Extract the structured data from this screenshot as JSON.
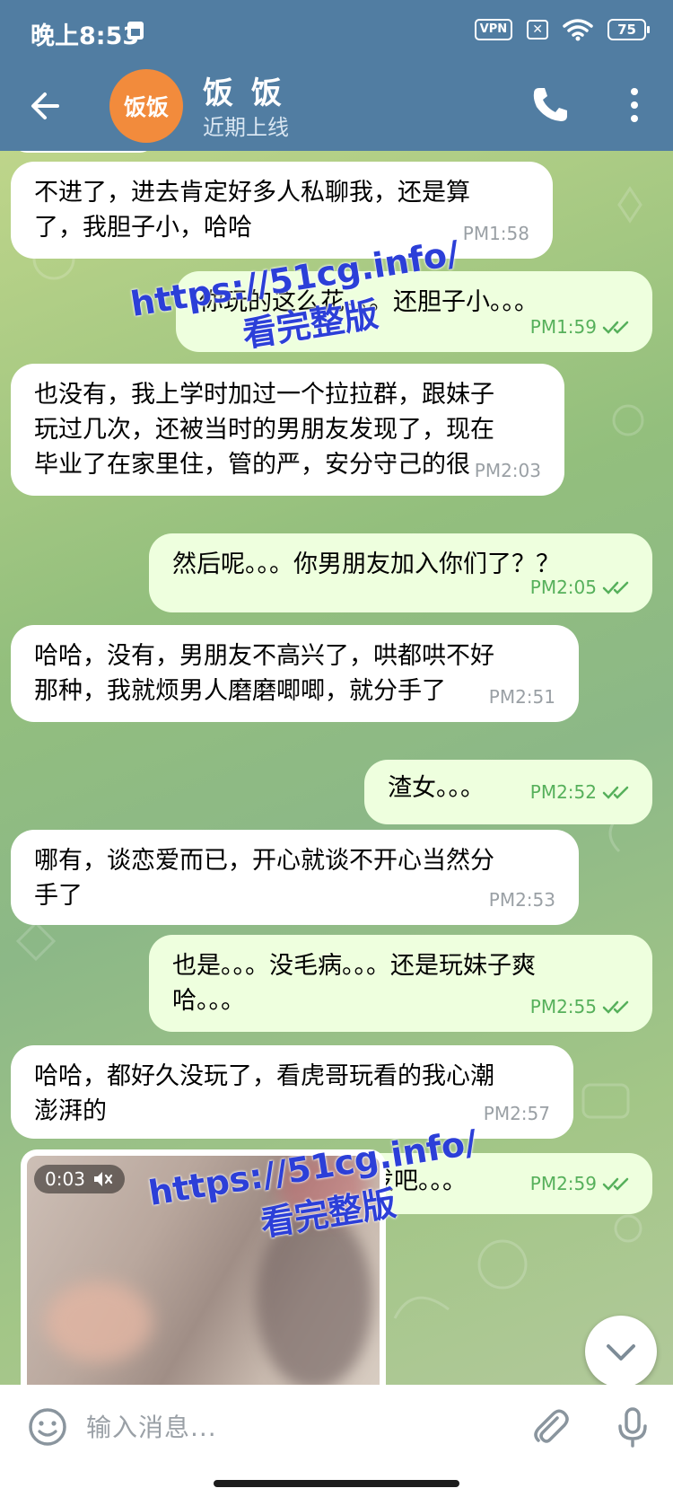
{
  "status_bar": {
    "time": "晚上8:53",
    "vpn": "VPN",
    "sim": "✕",
    "battery": "75",
    "icons": [
      "sim-card-icon",
      "vpn-icon",
      "no-sim-icon",
      "wifi-icon",
      "battery-icon"
    ]
  },
  "header": {
    "avatar_text": "饭饭",
    "avatar_color": "#f28b3c",
    "name": "饭 饭",
    "status": "近期上线",
    "bar_color": "#517da2"
  },
  "messages": [
    {
      "dir": "in",
      "text": "不进了，进去肯定好多人私聊我，还是算\n了，我胆子小，哈哈",
      "time": "PM1:58"
    },
    {
      "dir": "out",
      "text": "你玩的这么花。。。还胆子小。。。",
      "time": "PM1:59"
    },
    {
      "dir": "in",
      "text": "也没有，我上学时加过一个拉拉群，跟妹子\n玩过几次，还被当时的男朋友发现了，现在\n毕业了在家里住，管的严，安分守己的很",
      "time": "PM2:03"
    },
    {
      "dir": "out",
      "text": "然后呢。。。你男朋友加入你们了？？",
      "time": "PM2:05"
    },
    {
      "dir": "in",
      "text": "哈哈，没有，男朋友不高兴了，哄都哄不好\n那种，我就烦男人磨磨唧唧，就分手了",
      "time": "PM2:51"
    },
    {
      "dir": "out",
      "text": "渣女。。。",
      "time": "PM2:52"
    },
    {
      "dir": "in",
      "text": "哪有，谈恋爱而已，开心就谈不开心当然分\n手了",
      "time": "PM2:53"
    },
    {
      "dir": "out",
      "text": "也是。。。没毛病。。。还是玩妹子爽\n哈。。。",
      "time": "PM2:55"
    },
    {
      "dir": "in",
      "text": "哈哈，都好久没玩了，看虎哥玩看的我心潮\n澎湃的",
      "time": "PM2:57"
    },
    {
      "dir": "out",
      "text": "那就自摸一发吧。。。",
      "time": "PM2:59"
    }
  ],
  "video": {
    "duration": "0:03",
    "mute_icon": "speaker-muted-icon"
  },
  "watermarks": [
    {
      "line1": "https://51cg.info/",
      "line2": "看完整版"
    },
    {
      "line1": "https://51cg.info/",
      "line2": "看完整版"
    }
  ],
  "input": {
    "placeholder": "输入消息..."
  },
  "colors": {
    "incoming_bubble": "#ffffff",
    "outgoing_bubble": "#eeffde",
    "outgoing_time": "#56b05b",
    "watermark": "#2c3fd8"
  }
}
